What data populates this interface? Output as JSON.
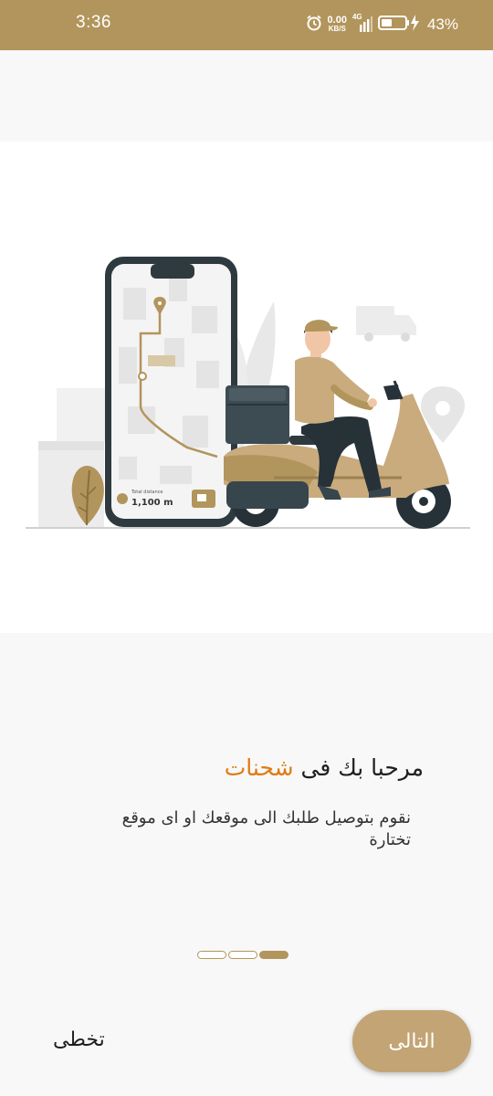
{
  "status_bar": {
    "time": "3:36",
    "net_speed_value": "0.00",
    "net_speed_unit": "KB/S",
    "network_type": "4G",
    "battery_percent": "43%"
  },
  "illustration": {
    "phone_label": "Total distance",
    "phone_value": "1,100 m"
  },
  "onboarding": {
    "title_prefix": "مرحبا بك فى ",
    "title_brand": "شحنات",
    "description": "نقوم بتوصيل طلبك الى موقعك او اى موقع تختارة",
    "page_count": 3,
    "active_index": 2
  },
  "actions": {
    "skip_label": "تخطى",
    "next_label": "التالى"
  },
  "colors": {
    "brand": "#b2955c",
    "accent": "#e07a12",
    "button": "#c3a475"
  }
}
